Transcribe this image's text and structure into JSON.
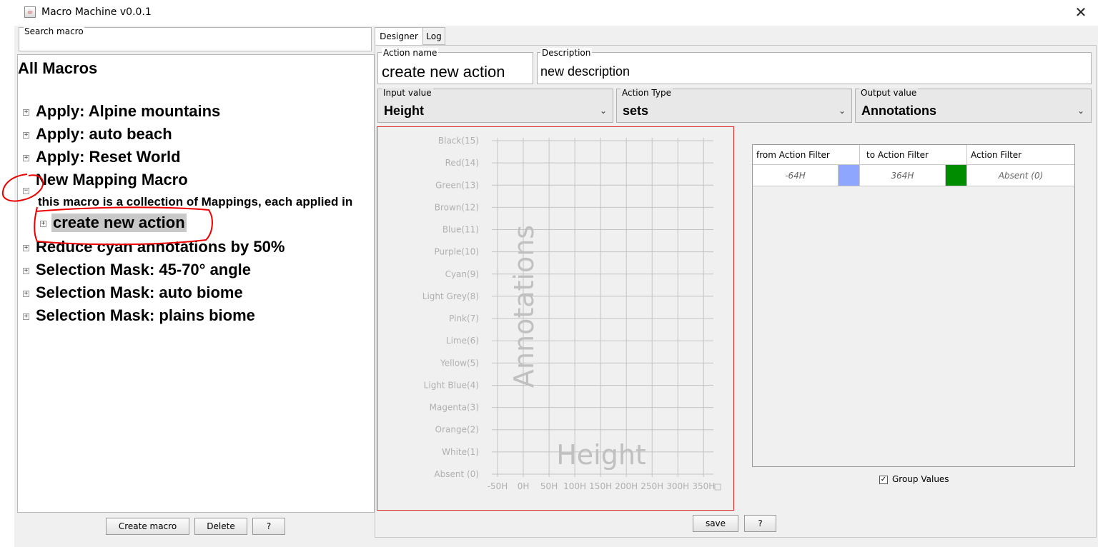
{
  "window": {
    "title": "Macro Machine v0.0.1",
    "close_glyph": "✕"
  },
  "search": {
    "label": "Search macro",
    "value": ""
  },
  "tree": {
    "root": "All Macros",
    "items": [
      {
        "label": "Apply: Alpine mountains",
        "expander": "+"
      },
      {
        "label": "Apply: auto beach",
        "expander": "+"
      },
      {
        "label": "Apply: Reset World",
        "expander": "+"
      },
      {
        "label": "New Mapping Macro",
        "expander": "−",
        "description": "this macro is a collection of Mappings, each applied in",
        "children": [
          {
            "label": "create new action",
            "expander": "+"
          }
        ]
      },
      {
        "label": "Reduce cyan annotations by 50%",
        "expander": "+"
      },
      {
        "label": "Selection Mask: 45-70° angle",
        "expander": "+"
      },
      {
        "label": "Selection Mask: auto biome",
        "expander": "+"
      },
      {
        "label": "Selection Mask: plains biome",
        "expander": "+"
      }
    ]
  },
  "left_buttons": {
    "create": "Create macro",
    "delete": "Delete",
    "help": "?"
  },
  "tabs": [
    {
      "label": "Designer"
    },
    {
      "label": "Log"
    }
  ],
  "designer": {
    "action_name": {
      "label": "Action name",
      "value": "create new action"
    },
    "description": {
      "label": "Description",
      "value": "new description"
    },
    "input_value": {
      "label": "Input value",
      "value": "Height"
    },
    "action_type": {
      "label": "Action Type",
      "value": "sets"
    },
    "output_value": {
      "label": "Output value",
      "value": "Annotations"
    },
    "save": "save",
    "help": "?",
    "group_values": {
      "label": "Group Values",
      "checked": true
    }
  },
  "filter_table": {
    "headers": [
      "from Action Filter",
      "to Action Filter",
      "Action Filter"
    ],
    "rows": [
      {
        "from": "-64H",
        "from_color": "#8fa6ff",
        "to": "364H",
        "to_color": "#008c00",
        "filter": "Absent (0)"
      }
    ]
  },
  "chart_data": {
    "type": "line",
    "xlabel": "Height",
    "ylabel": "Annotations",
    "x_ticks": [
      "-50H",
      "0H",
      "50H",
      "100H",
      "150H",
      "200H",
      "250H",
      "300H",
      "350H"
    ],
    "y_ticks": [
      "Absent (0)",
      "White(1)",
      "Orange(2)",
      "Magenta(3)",
      "Light Blue(4)",
      "Yellow(5)",
      "Lime(6)",
      "Pink(7)",
      "Light Grey(8)",
      "Cyan(9)",
      "Purple(10)",
      "Blue(11)",
      "Brown(12)",
      "Green(13)",
      "Red(14)",
      "Black(15)"
    ],
    "grid": true
  }
}
